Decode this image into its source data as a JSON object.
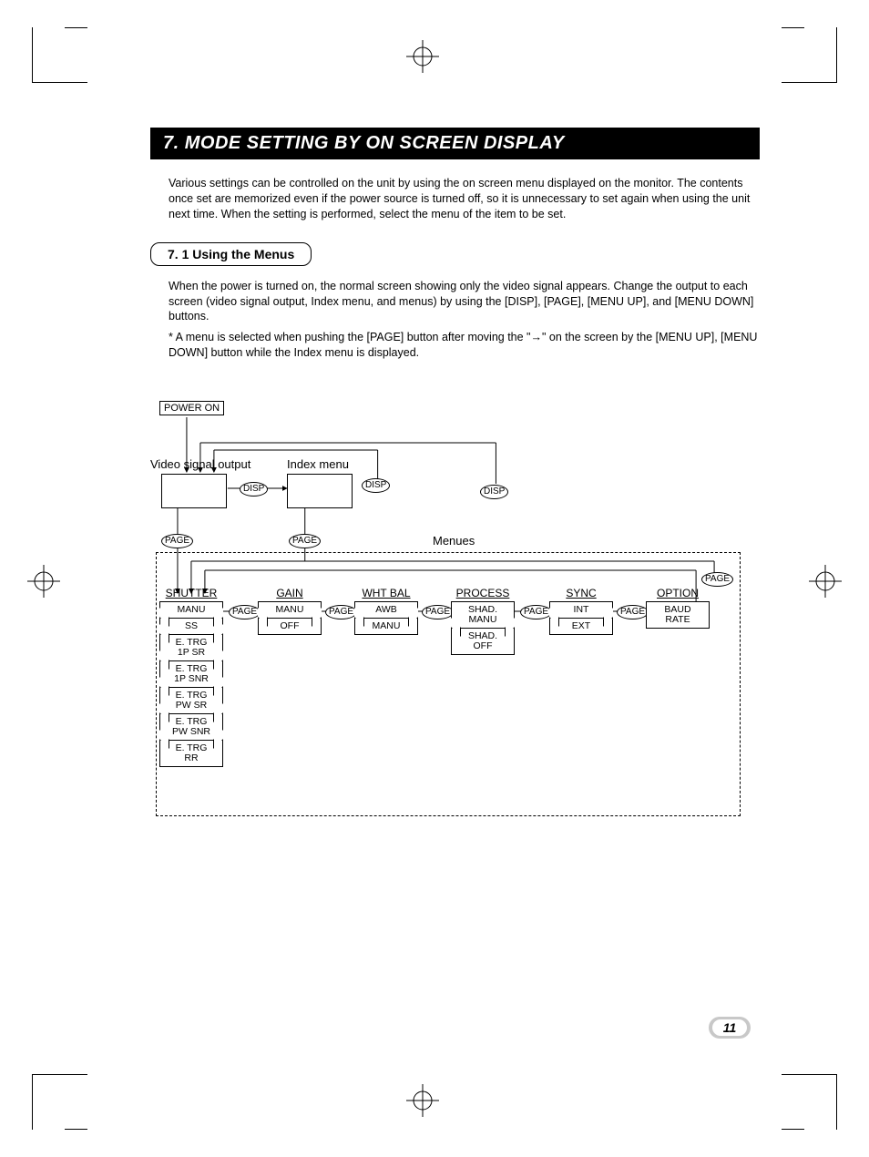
{
  "header": {
    "title": "7. MODE SETTING BY ON SCREEN DISPLAY"
  },
  "intro": "Various settings can be controlled on the unit by using the on screen menu displayed on the monitor. The contents once set are memorized even if the power source is turned off, so it is unnecessary to set again when using the unit next time. When the setting is performed, select the menu of the item to be set.",
  "subsection": {
    "heading": "7. 1   Using the Menus"
  },
  "sub_text": "When the power is turned on, the normal screen showing only the video signal appears. Change the output to each screen (video signal output, Index menu, and menus) by using the [DISP], [PAGE], [MENU UP], and [MENU DOWN] buttons.",
  "note_text": "*  A menu is selected when pushing the [PAGE] button after moving the \"→\" on the screen by the [MENU UP], [MENU DOWN] button while the Index menu is displayed.",
  "diagram": {
    "power_on": "POWER ON",
    "video_label": "Video signal output",
    "index_label": "Index menu",
    "menues_label": "Menues",
    "disp": "DISP",
    "page": "PAGE",
    "columns": [
      {
        "head": "SHUTTER",
        "opts": [
          "MANU",
          "SS",
          "E. TRG\n1P SR",
          "E. TRG\n1P SNR",
          "E. TRG\nPW SR",
          "E. TRG\nPW SNR",
          "E. TRG\nRR"
        ]
      },
      {
        "head": "GAIN",
        "opts": [
          "MANU",
          "OFF"
        ]
      },
      {
        "head": "WHT BAL",
        "opts": [
          "AWB",
          "MANU"
        ]
      },
      {
        "head": "PROCESS",
        "opts": [
          "SHAD.\nMANU",
          "SHAD.\nOFF"
        ]
      },
      {
        "head": "SYNC",
        "opts": [
          "INT",
          "EXT"
        ]
      },
      {
        "head": "OPTION",
        "opts": [
          "BAUD\nRATE"
        ]
      }
    ]
  },
  "page_number": "11"
}
